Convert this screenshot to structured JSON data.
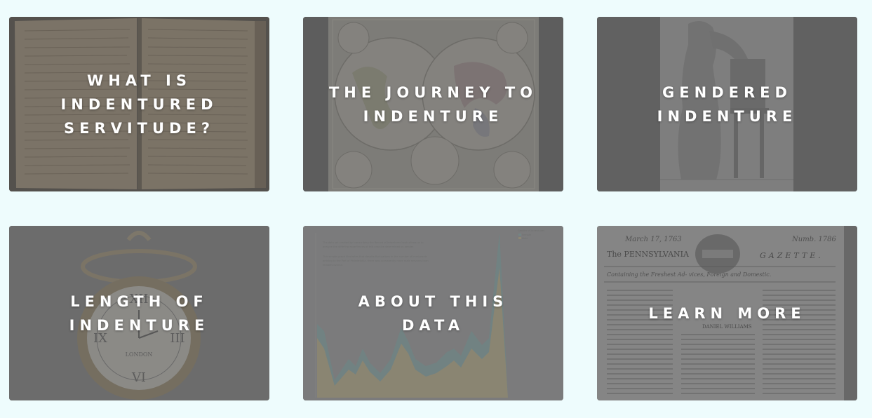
{
  "cards": [
    {
      "title": "WHAT IS INDENTURED SERVITUDE?",
      "image": "open-manuscript-book"
    },
    {
      "title": "THE JOURNEY TO INDENTURE",
      "image": "world-map-hemispheres"
    },
    {
      "title": "GENDERED INDENTURE",
      "image": "woman-at-desk-engraving"
    },
    {
      "title": "LENGTH OF INDENTURE",
      "image": "pocket-watch"
    },
    {
      "title": "ABOUT THIS DATA",
      "image": "area-chart-preview"
    },
    {
      "title": "LEARN MORE",
      "image": "pennsylvania-gazette-newspaper"
    }
  ],
  "thumbnails": {
    "chart": {
      "legend_title": "Gender of Indentures",
      "legend_items": [
        "Female",
        "Male"
      ],
      "intro_lines": [
        "The data set created by transcribing the Record of Indentures book allows us to",
        "analyze the differing experiences of this practice determined by gender.",
        "This simple graph illustrates that despite fluctuations in the number of immigrants",
        "arriving to the Port of Philadelphia, there was consistently more male servants than",
        "females overall."
      ]
    },
    "gazette": {
      "date": "March 17, 1763",
      "issue": "Numb. 1786",
      "masthead_left": "The PENNSYLVANIA",
      "masthead_right": "GAZETTE.",
      "subtitle": "Containing the Freshest Ad- vices, Foreign and Domestic.",
      "name": "DANIEL WILLIAMS"
    },
    "watch": {
      "maker": "LONDON"
    }
  }
}
